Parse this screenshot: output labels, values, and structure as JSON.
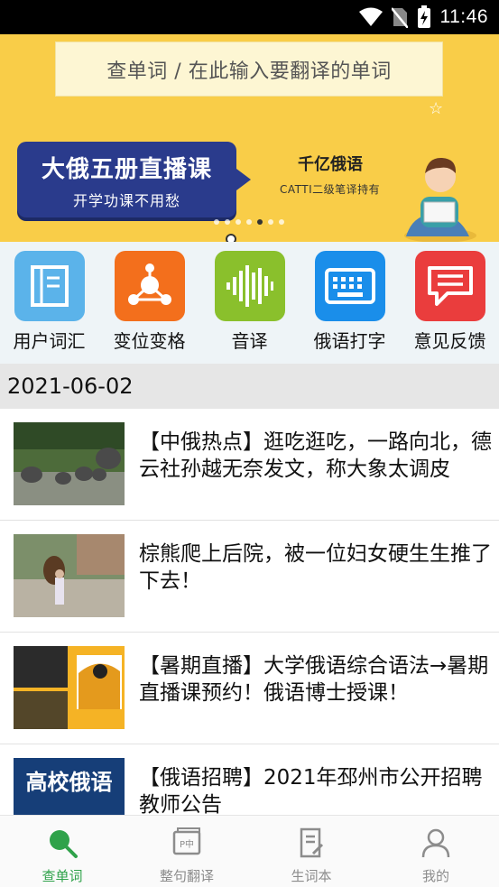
{
  "status_bar": {
    "time": "11:46"
  },
  "banner": {
    "search_placeholder": "查单词 / 在此输入要翻译的单词",
    "promo_title": "大俄五册直播课",
    "promo_subtitle": "开学功课不用愁",
    "brand_name": "千亿俄语",
    "brand_tagline": "CATTI二级笔译持有",
    "carousel_total": 7,
    "carousel_active_index": 4
  },
  "tools": [
    {
      "label": "用户词汇",
      "icon": "notebook-icon",
      "color": "#5bb3ea"
    },
    {
      "label": "变位变格",
      "icon": "network-icon",
      "color": "#f36f1c"
    },
    {
      "label": "音译",
      "icon": "soundwave-icon",
      "color": "#8ac02c"
    },
    {
      "label": "俄语打字",
      "icon": "keyboard-icon",
      "color": "#1a8eea"
    },
    {
      "label": "意见反馈",
      "icon": "chat-bubble-icon",
      "color": "#ea3d3d"
    }
  ],
  "date": "2021-06-02",
  "news": [
    {
      "title": "【中俄热点】逛吃逛吃，一路向北，德云社孙越无奈发文，称大象太调皮",
      "thumb": "elephants-photo"
    },
    {
      "title": "棕熊爬上后院，被一位妇女硬生生推了下去！",
      "thumb": "bear-backyard-photo"
    },
    {
      "title": "【暑期直播】大学俄语综合语法→暑期直播课预约！俄语博士授课！",
      "thumb": "live-course-illustration"
    },
    {
      "title": "【俄语招聘】2021年邳州市公开招聘教师公告",
      "thumb": "recruitment-poster",
      "thumb_text": "高校俄语"
    }
  ],
  "bottom_nav": [
    {
      "label": "查单词",
      "icon": "search-icon",
      "active": true
    },
    {
      "label": "整句翻译",
      "icon": "translate-icon",
      "active": false
    },
    {
      "label": "生词本",
      "icon": "vocab-notebook-icon",
      "active": false
    },
    {
      "label": "我的",
      "icon": "profile-icon",
      "active": false
    }
  ],
  "colors": {
    "accent": "#2fa24a",
    "banner_bg": "#f9cd48",
    "promo_bg": "#2a3b8c"
  }
}
